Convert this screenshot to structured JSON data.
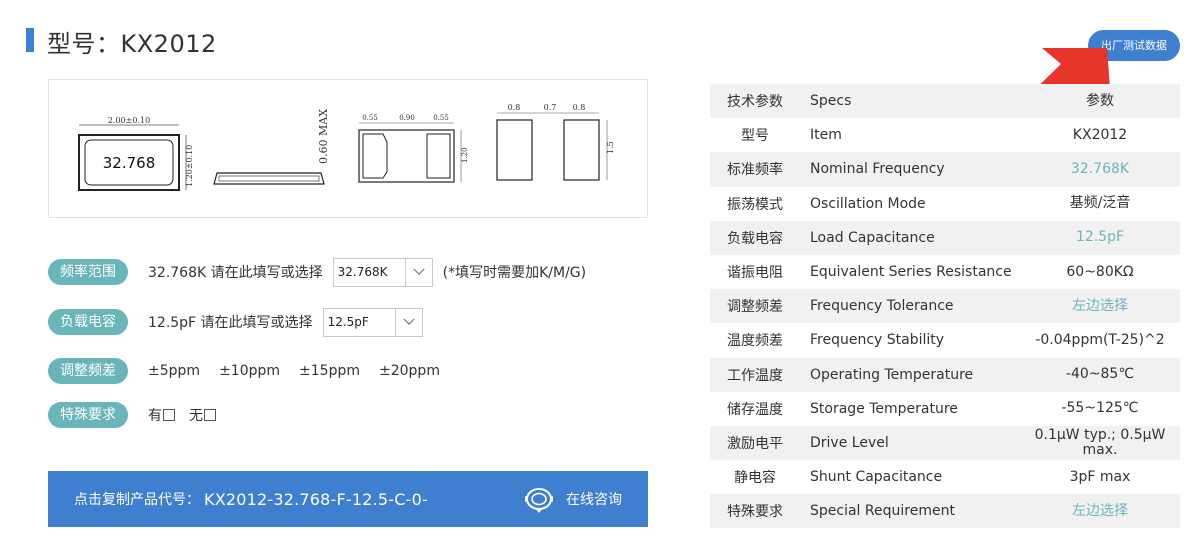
{
  "header": {
    "title": "型号：KX2012",
    "factory_test_button": "出厂测试数据"
  },
  "drawing": {
    "dim_width": "2.00±0.10",
    "dim_height": "1.20±0.10",
    "marking": "32.768",
    "dim_max_height": "0.60 MAX",
    "pad_dims_top": [
      "0.55",
      "0.90",
      "0.55"
    ],
    "pad_dim_side": "1.20",
    "land_dims_top": [
      "0.8",
      "0.7",
      "0.8"
    ],
    "land_dim_side": "1.5"
  },
  "options": {
    "frequency": {
      "label": "频率范围",
      "text": "32.768K 请在此填写或选择",
      "select_value": "32.768K",
      "hint": "(*填写时需要加K/M/G)"
    },
    "load_cap": {
      "label": "负载电容",
      "text": "12.5pF 请在此填写或选择",
      "select_value": "12.5pF"
    },
    "tolerance": {
      "label": "调整频差",
      "choices": [
        "±5ppm",
        "±10ppm",
        "±15ppm",
        "±20ppm"
      ]
    },
    "special": {
      "label": "特殊要求",
      "yes": "有",
      "no": "无"
    }
  },
  "copy_bar": {
    "label": "点击复制产品代号：",
    "code": "KX2012-32.768-F-12.5-C-0-",
    "consult": "在线咨询"
  },
  "specs": {
    "header": {
      "cn": "技术参数",
      "en": "Specs",
      "val": "参数"
    },
    "rows": [
      {
        "cn": "型号",
        "en": "Item",
        "val": "KX2012",
        "accent": false
      },
      {
        "cn": "标准频率",
        "en": "Nominal Frequency",
        "val": "32.768K",
        "accent": true
      },
      {
        "cn": "振荡模式",
        "en": "Oscillation Mode",
        "val": "基频/泛音",
        "accent": false
      },
      {
        "cn": "负载电容",
        "en": "Load Capacitance",
        "val": "12.5pF",
        "accent": true
      },
      {
        "cn": "谐振电阻",
        "en": "Equivalent Series Resistance",
        "val": "60~80KΩ",
        "accent": false
      },
      {
        "cn": "调整频差",
        "en": "Frequency Tolerance",
        "val": "左边选择",
        "accent": true
      },
      {
        "cn": "温度频差",
        "en": "Frequency Stability",
        "val": "-0.04ppm(T-25)^2",
        "accent": false
      },
      {
        "cn": "工作温度",
        "en": "Operating Temperature",
        "val": "-40~85℃",
        "accent": false
      },
      {
        "cn": "储存温度",
        "en": "Storage Temperature",
        "val": "-55~125℃",
        "accent": false
      },
      {
        "cn": "激励电平",
        "en": "Drive Level",
        "val": "0.1μW typ.; 0.5μW max.",
        "accent": false
      },
      {
        "cn": "静电容",
        "en": "Shunt Capacitance",
        "val": "3pF max",
        "accent": false
      },
      {
        "cn": "特殊要求",
        "en": "Special Requirement",
        "val": "左边选择",
        "accent": true
      }
    ]
  },
  "colors": {
    "accent_blue": "#3f7fd0",
    "teal": "#6ab5ba",
    "arrow_red": "#e8352b"
  }
}
